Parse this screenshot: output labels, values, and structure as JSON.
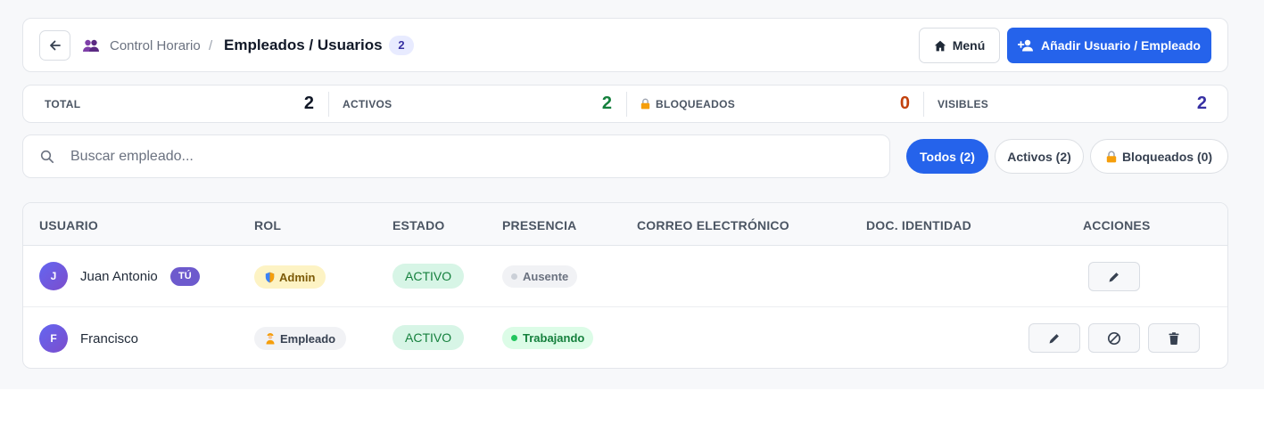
{
  "header": {
    "back_icon": "arrow-left-icon",
    "section_icon": "users-icon",
    "breadcrumb_parent": "Control Horario",
    "breadcrumb_sep": "/",
    "title": "Empleados / Usuarios",
    "count": "2",
    "menu_label": "Menú",
    "add_label": "Añadir Usuario / Empleado",
    "accent": "#2563eb"
  },
  "stats": [
    {
      "label": "TOTAL",
      "value": "2",
      "color": "#111827"
    },
    {
      "label": "ACTIVOS",
      "value": "2",
      "color": "#15803d"
    },
    {
      "label": "BLOQUEADOS",
      "value": "0",
      "color": "#c2410c",
      "icon": "lock-icon"
    },
    {
      "label": "VISIBLES",
      "value": "2",
      "color": "#3730a3"
    }
  ],
  "search": {
    "placeholder": "Buscar empleado..."
  },
  "filters": [
    {
      "label": "Todos (2)",
      "active": true
    },
    {
      "label": "Activos (2)",
      "active": false
    },
    {
      "label": "Bloqueados (0)",
      "active": false,
      "icon": "lock-icon"
    }
  ],
  "table": {
    "columns": [
      "USUARIO",
      "ROL",
      "ESTADO",
      "PRESENCIA",
      "CORREO ELECTRÓNICO",
      "DOC. IDENTIDAD",
      "ACCIONES"
    ],
    "rows": [
      {
        "initial": "J",
        "name": "Juan Antonio",
        "badge": "TÚ",
        "role": "Admin",
        "role_icon": "shield-icon",
        "status": "ACTIVO",
        "presence": "Ausente",
        "email": "",
        "doc": "",
        "actions": [
          "edit-icon"
        ]
      },
      {
        "initial": "F",
        "name": "Francisco",
        "badge": "",
        "role": "Empleado",
        "role_icon": "worker-icon",
        "status": "ACTIVO",
        "presence": "Trabajando",
        "email": "",
        "doc": "",
        "actions": [
          "edit-icon",
          "block-icon",
          "trash-icon"
        ]
      }
    ]
  }
}
